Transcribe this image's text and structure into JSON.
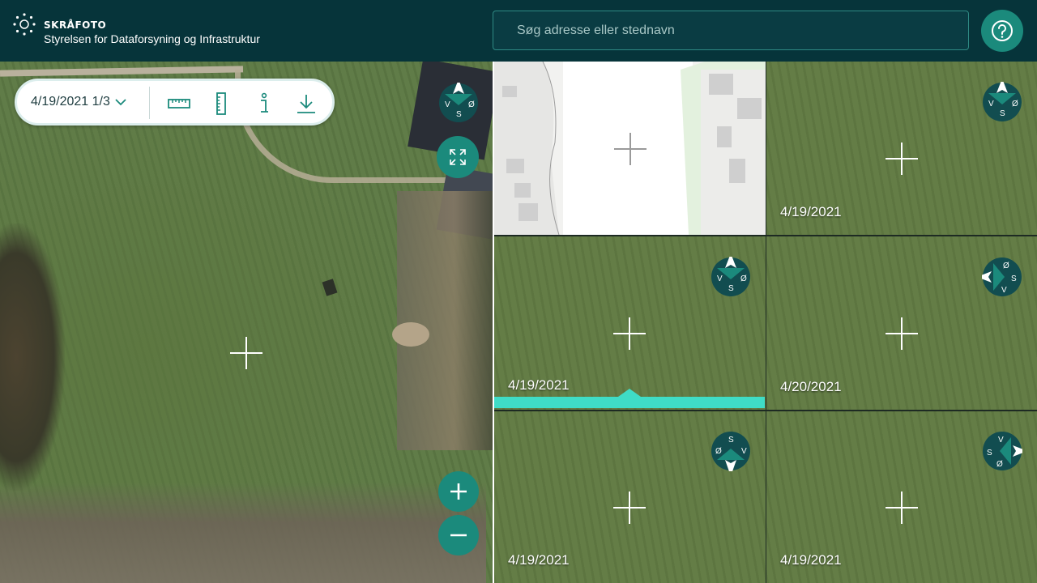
{
  "header": {
    "app_name": "SKRÅFOTO",
    "org_name": "Styrelsen for Dataforsyning og Infrastruktur",
    "search_placeholder": "Søg adresse eller stednavn",
    "help_icon": "question-icon"
  },
  "toolbar": {
    "date_select_value": "4/19/2021 1/3",
    "tools": [
      "ruler-horizontal-icon",
      "ruler-vertical-icon",
      "info-icon",
      "download-icon"
    ]
  },
  "main_view": {
    "compass": {
      "north": "",
      "west": "V",
      "east": "Ø",
      "south": "S"
    },
    "zoom_in": "+",
    "zoom_out": "−"
  },
  "tiles": [
    {
      "type": "map",
      "date": ""
    },
    {
      "type": "photo",
      "date": "4/19/2021",
      "compass": {
        "west": "V",
        "east": "Ø",
        "south": "S"
      }
    },
    {
      "type": "photo",
      "date": "4/19/2021",
      "active": true,
      "compass": {
        "west": "V",
        "east": "Ø",
        "south": "S"
      }
    },
    {
      "type": "photo",
      "date": "4/20/2021",
      "compass": {
        "a": "Ø",
        "b": "S",
        "c": "V"
      }
    },
    {
      "type": "photo",
      "date": "4/19/2021",
      "compass": {
        "a": "S",
        "b": "Ø",
        "c": "V"
      }
    },
    {
      "type": "photo",
      "date": "4/19/2021",
      "compass": {
        "a": "V",
        "b": "S",
        "c": "Ø"
      }
    }
  ],
  "colors": {
    "header_bg": "#06343a",
    "accent": "#1b8a7c",
    "active": "#3fdcc6"
  }
}
